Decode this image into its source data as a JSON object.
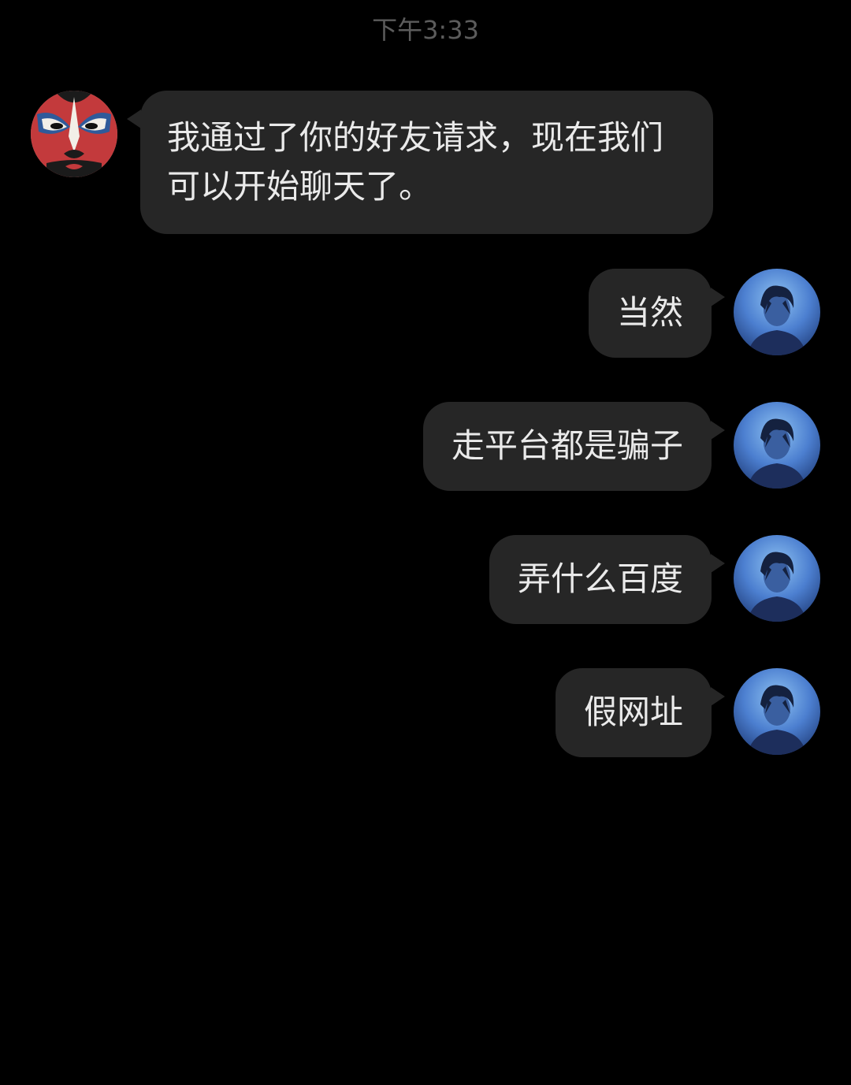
{
  "status": {
    "time": "下午3:33"
  },
  "colors": {
    "background": "#000000",
    "bubble": "#262626",
    "text": "#eaeaea",
    "timestamp": "#5c5c5c"
  },
  "contact": {
    "avatar_icon": "opera-mask-avatar-icon"
  },
  "me": {
    "avatar_icon": "anime-boy-avatar-icon"
  },
  "messages": [
    {
      "side": "incoming",
      "text": "我通过了你的好友请求，现在我们可以开始聊天了。"
    },
    {
      "side": "outgoing",
      "text": "当然"
    },
    {
      "side": "outgoing",
      "text": "走平台都是骗子"
    },
    {
      "side": "outgoing",
      "text": "弄什么百度"
    },
    {
      "side": "outgoing",
      "text": "假网址"
    }
  ]
}
